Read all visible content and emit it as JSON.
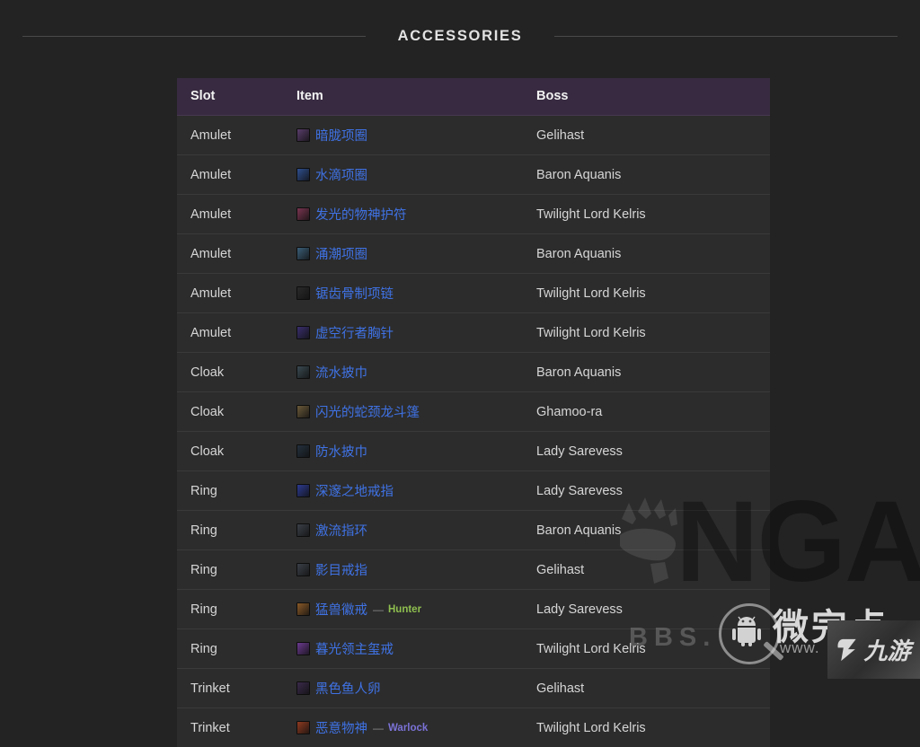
{
  "section": {
    "title": "ACCESSORIES"
  },
  "table": {
    "columns": {
      "slot": "Slot",
      "item": "Item",
      "boss": "Boss"
    },
    "rows": [
      {
        "slot": "Amulet",
        "item": "暗胧项圈",
        "quality": "rare",
        "icon": "#5a3d6b",
        "class_tag": "",
        "boss": "Gelihast"
      },
      {
        "slot": "Amulet",
        "item": "水滴项圈",
        "quality": "rare",
        "icon": "#2f4f8f",
        "class_tag": "",
        "boss": "Baron Aquanis"
      },
      {
        "slot": "Amulet",
        "item": "发光的物神护符",
        "quality": "rare",
        "icon": "#7a3550",
        "class_tag": "",
        "boss": "Twilight Lord Kelris"
      },
      {
        "slot": "Amulet",
        "item": "涌潮项圈",
        "quality": "rare",
        "icon": "#3b5f78",
        "class_tag": "",
        "boss": "Baron Aquanis"
      },
      {
        "slot": "Amulet",
        "item": "锯齿骨制项链",
        "quality": "rare",
        "icon": "#2a2a2a",
        "class_tag": "",
        "boss": "Twilight Lord Kelris"
      },
      {
        "slot": "Amulet",
        "item": "虚空行者胸针",
        "quality": "rare",
        "icon": "#3a2f6e",
        "class_tag": "",
        "boss": "Twilight Lord Kelris"
      },
      {
        "slot": "Cloak",
        "item": "流水披巾",
        "quality": "rare",
        "icon": "#3a4a52",
        "class_tag": "",
        "boss": "Baron Aquanis"
      },
      {
        "slot": "Cloak",
        "item": "闪光的蛇颈龙斗篷",
        "quality": "rare",
        "icon": "#6b5a3a",
        "class_tag": "",
        "boss": "Ghamoo-ra"
      },
      {
        "slot": "Cloak",
        "item": "防水披巾",
        "quality": "rare",
        "icon": "#24303d",
        "class_tag": "",
        "boss": "Lady Sarevess"
      },
      {
        "slot": "Ring",
        "item": "深邃之地戒指",
        "quality": "rare",
        "icon": "#2c3a8f",
        "class_tag": "",
        "boss": "Lady Sarevess"
      },
      {
        "slot": "Ring",
        "item": "激流指环",
        "quality": "rare",
        "icon": "#3b4048",
        "class_tag": "",
        "boss": "Baron Aquanis"
      },
      {
        "slot": "Ring",
        "item": "影目戒指",
        "quality": "rare",
        "icon": "#3b4048",
        "class_tag": "",
        "boss": "Gelihast"
      },
      {
        "slot": "Ring",
        "item": "猛兽徽戒",
        "quality": "rare",
        "icon": "#8a5a28",
        "class_tag": "Hunter",
        "boss": "Lady Sarevess"
      },
      {
        "slot": "Ring",
        "item": "暮光领主玺戒",
        "quality": "rare",
        "icon": "#6b3a8f",
        "class_tag": "",
        "boss": "Twilight Lord Kelris"
      },
      {
        "slot": "Trinket",
        "item": "黑色鱼人卵",
        "quality": "rare",
        "icon": "#3a2a4a",
        "class_tag": "",
        "boss": "Gelihast"
      },
      {
        "slot": "Trinket",
        "item": "恶意物神",
        "quality": "rare",
        "icon": "#8f3a20",
        "class_tag": "Warlock",
        "boss": "Twilight Lord Kelris"
      }
    ]
  },
  "class_colors": {
    "Hunter": "#8fbf4f",
    "Warlock": "#7b72d6"
  },
  "colors": {
    "page_background": "#232323",
    "table_header_background": "#382b41",
    "row_background": "#2c2c2c",
    "row_divider": "#3a3a3a",
    "item_link": "#3f72e4",
    "rule": "#4a4a4a",
    "title_text": "#e2e2e2"
  },
  "watermarks": {
    "nga_logo_text": "NGA",
    "bbs_text": "BBS.",
    "site_cn": "微完点",
    "site_www": "www.",
    "jiuyou_text": "九游"
  }
}
